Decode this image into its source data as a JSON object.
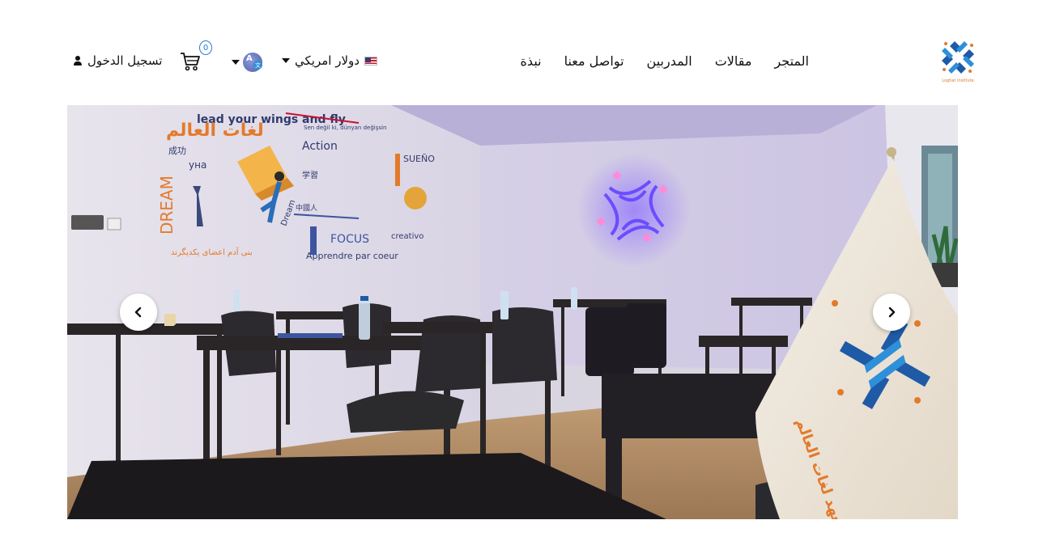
{
  "header": {
    "login_label": "تسجيل الدخول",
    "cart_count": "0",
    "currency_label": "دولار امريكي",
    "nav": [
      "المتجر",
      "مقالات",
      "المدربين",
      "تواصل معنا",
      "نبذة"
    ],
    "logo_text": "Loghat Institute"
  },
  "hero": {
    "wall_texts": [
      "lead your wings and fly",
      "لغات العالم",
      "Action",
      "DREAM",
      "FOCUS",
      "Apprendre par coeur",
      "creativo",
      "SUEÑO",
      "Sen değil ki, dünyan değişsin",
      "بنی آدم اعضای یکدیگرند",
      "成功",
      "学習",
      "中國人",
      "Dream",
      "yнa"
    ],
    "slide_index": 1
  },
  "colors": {
    "brand_blue": "#1f5aa6",
    "brand_orange": "#e37a2b",
    "accent": "#2a7bd1"
  }
}
